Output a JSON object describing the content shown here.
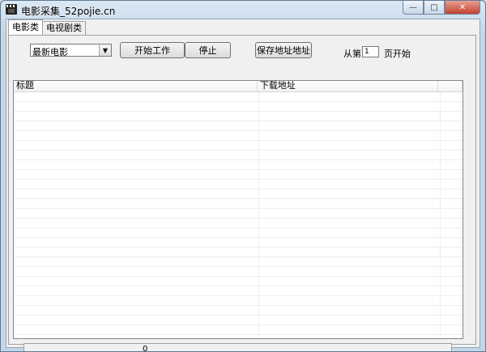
{
  "window": {
    "title": "电影采集_52pojie.cn",
    "buttons": {
      "minimize": "—",
      "maximize": "□",
      "close": "✕"
    }
  },
  "tabs": [
    {
      "label": "电影类",
      "active": true
    },
    {
      "label": "电视剧类",
      "active": false
    }
  ],
  "controls": {
    "category_selected": "最新电影",
    "start_label": "开始工作",
    "stop_label": "停止",
    "save_label": "保存地址地址",
    "from_label": "从第",
    "page_value": "1",
    "page_suffix": "页开始"
  },
  "list": {
    "columns": [
      "标题",
      "下载地址",
      ""
    ],
    "rows": []
  },
  "status": {
    "count": "0"
  },
  "icons": {
    "app": "clapperboard-icon",
    "dropdown": "chevron-down-icon"
  }
}
